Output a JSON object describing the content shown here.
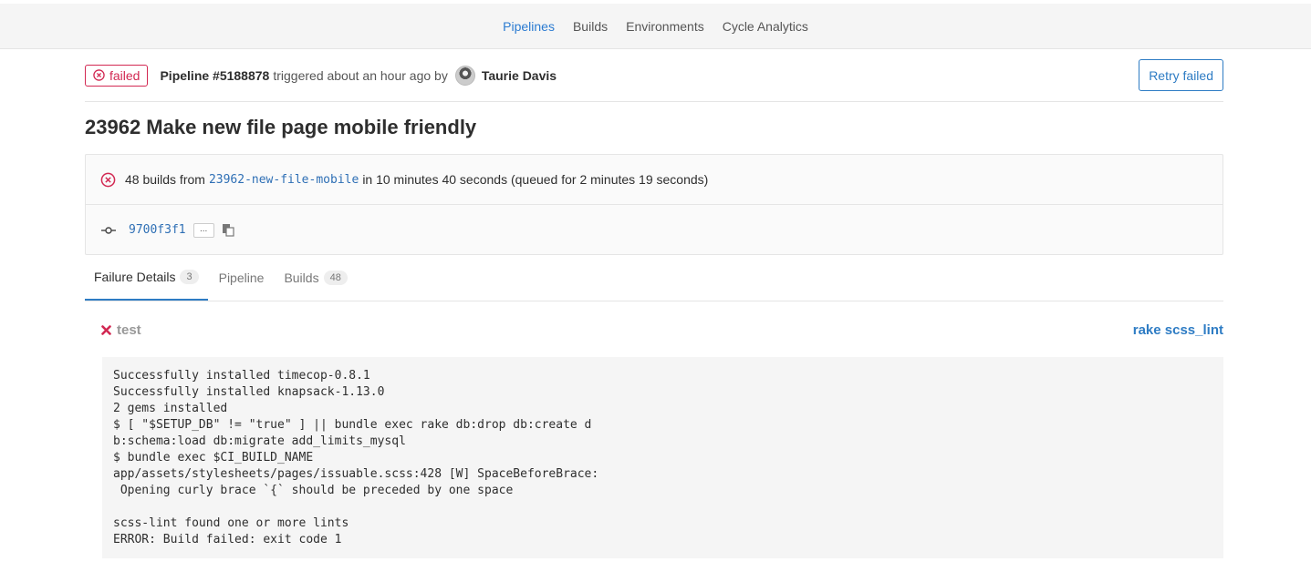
{
  "nav": {
    "items": [
      {
        "label": "Pipelines",
        "active": true
      },
      {
        "label": "Builds",
        "active": false
      },
      {
        "label": "Environments",
        "active": false
      },
      {
        "label": "Cycle Analytics",
        "active": false
      }
    ]
  },
  "header": {
    "status": "failed",
    "pipeline_label": "Pipeline #5188878",
    "triggered_text": "triggered about an hour ago by",
    "user_name": "Taurie Davis",
    "retry_label": "Retry failed"
  },
  "title": "23962 Make new file page mobile friendly",
  "info": {
    "builds_prefix": "48 builds from",
    "branch": "23962-new-file-mobile",
    "builds_suffix": "in 10 minutes 40 seconds (queued for 2 minutes 19 seconds)",
    "commit_sha": "9700f3f1",
    "ellipsis": "..."
  },
  "tabs": [
    {
      "label": "Failure Details",
      "count": "3",
      "active": true
    },
    {
      "label": "Pipeline",
      "count": "",
      "active": false
    },
    {
      "label": "Builds",
      "count": "48",
      "active": false
    }
  ],
  "failure": {
    "stage": "test",
    "job": "rake scss_lint",
    "log": "Successfully installed timecop-0.8.1\nSuccessfully installed knapsack-1.13.0\n2 gems installed\n$ [ \"$SETUP_DB\" != \"true\" ] || bundle exec rake db:drop db:create d\nb:schema:load db:migrate add_limits_mysql\n$ bundle exec $CI_BUILD_NAME\napp/assets/stylesheets/pages/issuable.scss:428 [W] SpaceBeforeBrace:\n Opening curly brace `{` should be preceded by one space\n\nscss-lint found one or more lints\nERROR: Build failed: exit code 1"
  },
  "colors": {
    "accent": "#2e7cc4",
    "failed": "#d22852"
  }
}
